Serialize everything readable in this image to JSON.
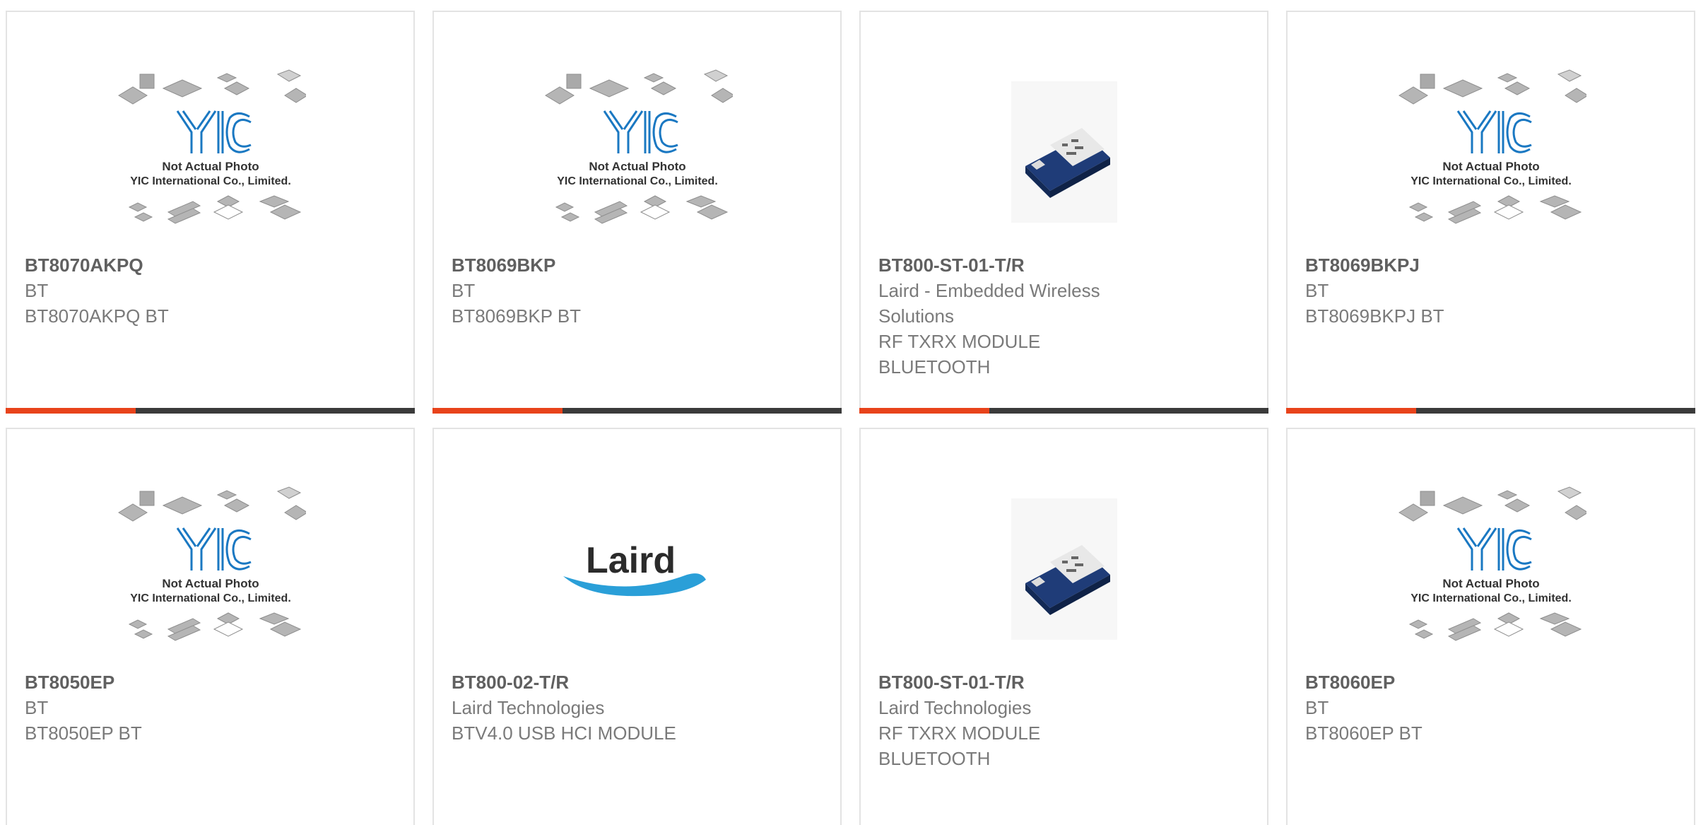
{
  "colors": {
    "accent_bar": "#e8431b",
    "dark_bar": "#3b3b3b",
    "yic_blue": "#1a78c2",
    "laird_blue": "#2a9fd8"
  },
  "products": [
    {
      "part_number": "BT8070AKPQ",
      "line1": "BT",
      "line2": "BT8070AKPQ BT",
      "line3": "",
      "image": "yic-placeholder-image",
      "placeholder_text": [
        "Not Actual Photo",
        "YIC International Co., Limited."
      ]
    },
    {
      "part_number": "BT8069BKP",
      "line1": "BT",
      "line2": "BT8069BKP BT",
      "line3": "",
      "image": "yic-placeholder-image",
      "placeholder_text": [
        "Not Actual Photo",
        "YIC International Co., Limited."
      ]
    },
    {
      "part_number": "BT800-ST-01-T/R",
      "line1": "Laird - Embedded Wireless Solutions",
      "line2": "RF TXRX MODULE BLUETOOTH",
      "line3": "",
      "image": "bluetooth-module-photo"
    },
    {
      "part_number": "BT8069BKPJ",
      "line1": "BT",
      "line2": "BT8069BKPJ BT",
      "line3": "",
      "image": "yic-placeholder-image",
      "placeholder_text": [
        "Not Actual Photo",
        "YIC International Co., Limited."
      ]
    },
    {
      "part_number": "BT8050EP",
      "line1": "BT",
      "line2": "BT8050EP BT",
      "line3": "",
      "image": "yic-placeholder-image",
      "placeholder_text": [
        "Not Actual Photo",
        "YIC International Co., Limited."
      ]
    },
    {
      "part_number": "BT800-02-T/R",
      "line1": "Laird Technologies",
      "line2": "BTV4.0 USB HCI MODULE",
      "line3": "",
      "image": "laird-logo",
      "logo_text": "Laird"
    },
    {
      "part_number": "BT800-ST-01-T/R",
      "line1": "Laird Technologies",
      "line2": "RF TXRX MODULE BLUETOOTH",
      "line3": "",
      "image": "bluetooth-module-photo"
    },
    {
      "part_number": "BT8060EP",
      "line1": "BT",
      "line2": "BT8060EP BT",
      "line3": "",
      "image": "yic-placeholder-image",
      "placeholder_text": [
        "Not Actual Photo",
        "YIC International Co., Limited."
      ]
    }
  ]
}
